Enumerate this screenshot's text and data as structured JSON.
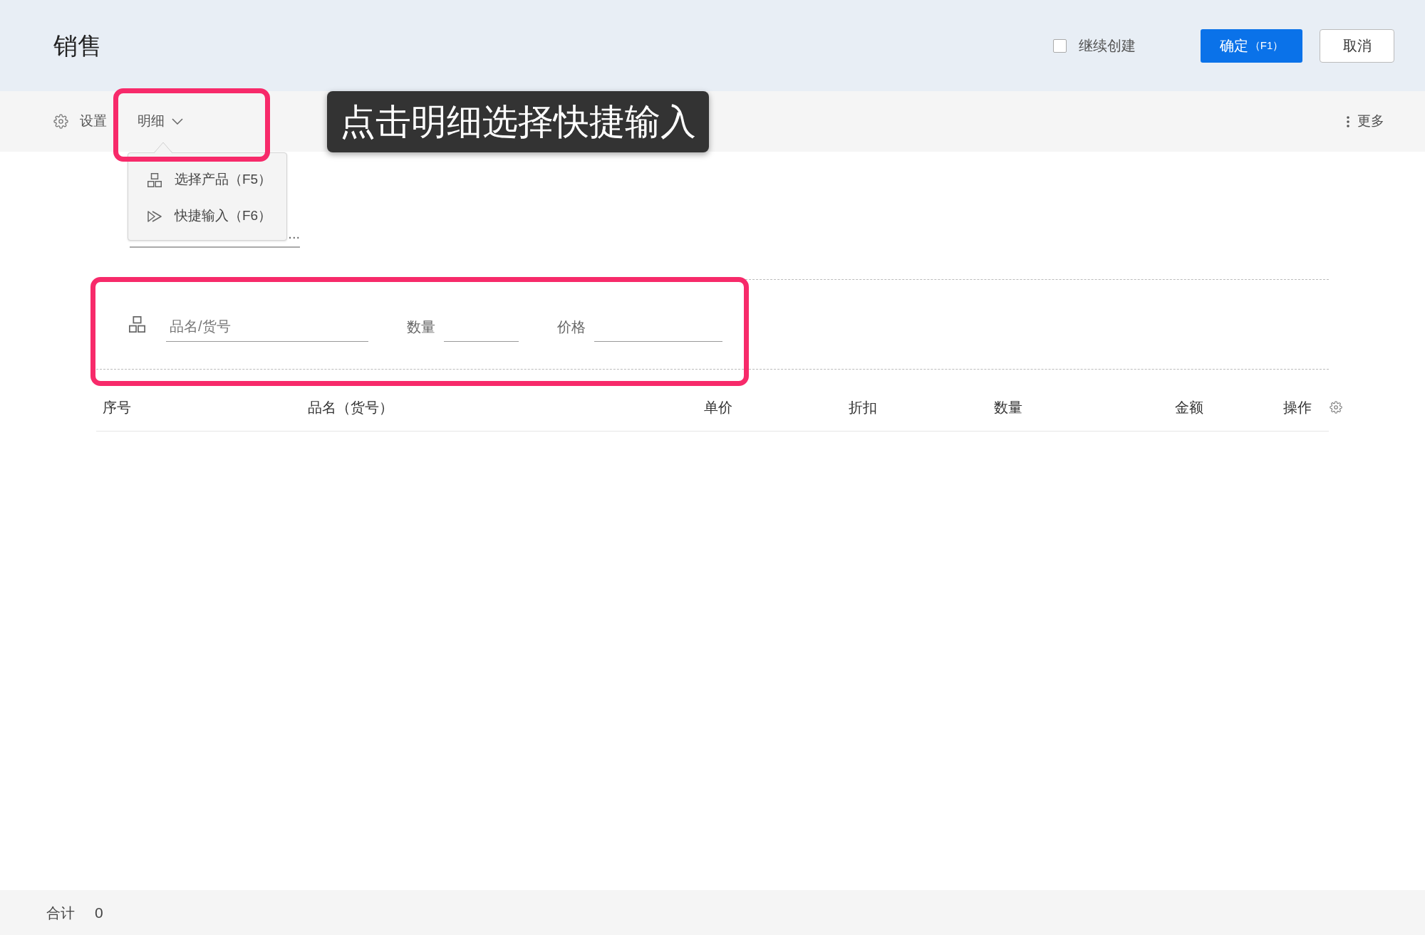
{
  "header": {
    "title": "销售",
    "continue_create": {
      "label": "继续创建",
      "checked": false
    },
    "buttons": [
      {
        "kind": "primary",
        "label": "确定",
        "shortcut": "（F1）"
      },
      {
        "kind": "default",
        "label": "取消"
      }
    ]
  },
  "toolbar": {
    "items": [
      {
        "kind": "settings",
        "label": "设置"
      },
      {
        "kind": "dropdown",
        "label": "明细",
        "expanded": true,
        "menu": [
          {
            "kind": "product",
            "label": "选择产品（F5）"
          },
          {
            "kind": "quick_input",
            "label": "快捷输入（F6）"
          }
        ]
      }
    ],
    "more": {
      "label": "更多"
    }
  },
  "tooltip": {
    "text": "点击明细选择快捷输入"
  },
  "covered_field": {
    "value": "..."
  },
  "quick_input": {
    "fields": [
      {
        "kind": "product",
        "placeholder": "品名/货号"
      },
      {
        "kind": "number",
        "label": "数量"
      },
      {
        "kind": "number",
        "label": "价格"
      }
    ]
  },
  "table": {
    "columns": [
      "序号",
      "品名（货号）",
      "单价",
      "折扣",
      "数量",
      "金额",
      "操作"
    ]
  },
  "footer": {
    "label": "合计",
    "total": "0"
  }
}
